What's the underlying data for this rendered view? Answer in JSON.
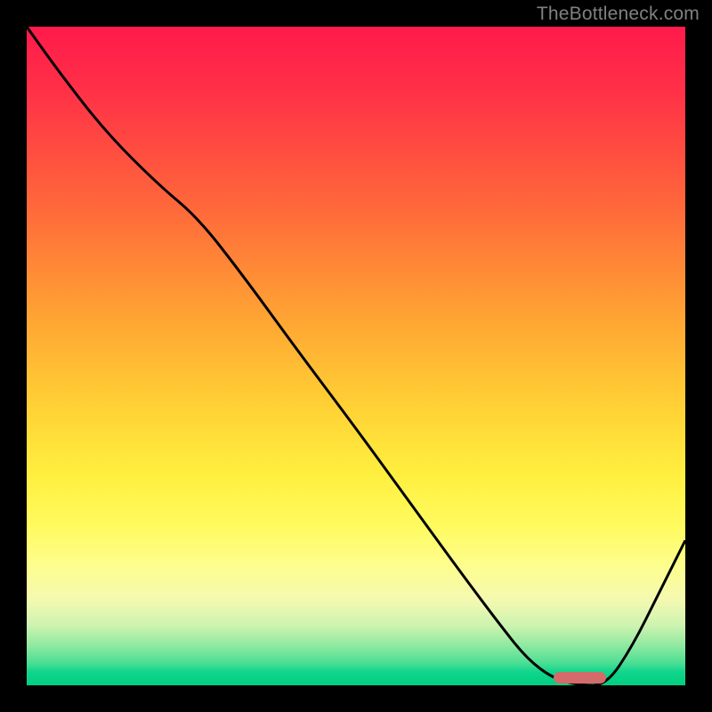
{
  "watermark": "TheBottleneck.com",
  "colors": {
    "curve_stroke": "#000000",
    "marker_fill": "#d46a6a",
    "background": "#000000"
  },
  "chart_data": {
    "type": "line",
    "title": "",
    "xlabel": "",
    "ylabel": "",
    "xlim": [
      0,
      100
    ],
    "ylim": [
      0,
      100
    ],
    "series": [
      {
        "name": "bottleneck-curve",
        "x": [
          0,
          5,
          12,
          20,
          26,
          33,
          41,
          50,
          58,
          66,
          72,
          76,
          80,
          84,
          88,
          92,
          96,
          100
        ],
        "y": [
          100,
          93,
          84,
          76,
          71,
          62,
          51,
          39,
          28,
          17,
          9,
          4,
          1,
          0,
          0,
          6,
          14,
          22
        ]
      }
    ],
    "marker": {
      "x_start": 80,
      "x_end": 88,
      "y": 0
    },
    "gradient_stops": [
      {
        "pos": 0,
        "color": "#ff1a4b"
      },
      {
        "pos": 0.28,
        "color": "#ff6a3a"
      },
      {
        "pos": 0.58,
        "color": "#ffd235"
      },
      {
        "pos": 0.82,
        "color": "#fdfd8f"
      },
      {
        "pos": 0.94,
        "color": "#8ee9a0"
      },
      {
        "pos": 1.0,
        "color": "#00cf80"
      }
    ]
  }
}
